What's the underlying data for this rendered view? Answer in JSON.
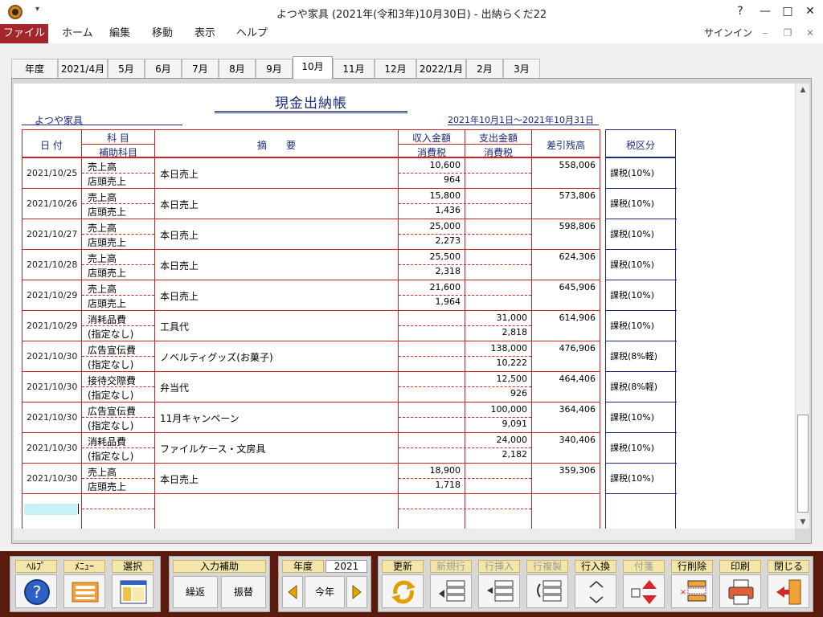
{
  "window": {
    "title": "よつや家具 (2021年(令和3年)10月30日) - 出納らくだ22",
    "help_glyph": "?",
    "minimize_glyph": "—",
    "restore_glyph": "□",
    "close_glyph": "✕"
  },
  "menu": {
    "items": [
      "ファイル",
      "ホーム",
      "編集",
      "移動",
      "表示",
      "ヘルプ"
    ],
    "signin": "サインイン"
  },
  "tabs": [
    "年度",
    "2021/4月",
    "5月",
    "6月",
    "7月",
    "8月",
    "9月",
    "10月",
    "11月",
    "12月",
    "2022/1月",
    "2月",
    "3月"
  ],
  "active_tab": "10月",
  "document": {
    "title": "現金出納帳",
    "company": "よつや家具",
    "period": "2021年10月1日～2021年10月31日",
    "headers": {
      "date": "日 付",
      "account": "科 目",
      "sub_account": "補助科目",
      "description": "摘　　要",
      "income": "収入金額",
      "income_tax": "消費税",
      "expense": "支出金額",
      "expense_tax": "消費税",
      "balance": "差引残高",
      "tax_class": "税区分"
    },
    "entries": [
      {
        "date": "2021/10/25",
        "account": "売上高",
        "sub": "店頭売上",
        "desc": "本日売上",
        "income": "10,600",
        "income_tax": "964",
        "expense": "",
        "expense_tax": "",
        "balance": "558,006",
        "tax": "課税(10%)"
      },
      {
        "date": "2021/10/26",
        "account": "売上高",
        "sub": "店頭売上",
        "desc": "本日売上",
        "income": "15,800",
        "income_tax": "1,436",
        "expense": "",
        "expense_tax": "",
        "balance": "573,806",
        "tax": "課税(10%)"
      },
      {
        "date": "2021/10/27",
        "account": "売上高",
        "sub": "店頭売上",
        "desc": "本日売上",
        "income": "25,000",
        "income_tax": "2,273",
        "expense": "",
        "expense_tax": "",
        "balance": "598,806",
        "tax": "課税(10%)"
      },
      {
        "date": "2021/10/28",
        "account": "売上高",
        "sub": "店頭売上",
        "desc": "本日売上",
        "income": "25,500",
        "income_tax": "2,318",
        "expense": "",
        "expense_tax": "",
        "balance": "624,306",
        "tax": "課税(10%)"
      },
      {
        "date": "2021/10/29",
        "account": "売上高",
        "sub": "店頭売上",
        "desc": "本日売上",
        "income": "21,600",
        "income_tax": "1,964",
        "expense": "",
        "expense_tax": "",
        "balance": "645,906",
        "tax": "課税(10%)"
      },
      {
        "date": "2021/10/29",
        "account": "消耗品費",
        "sub": "(指定なし)",
        "desc": "工具代",
        "income": "",
        "income_tax": "",
        "expense": "31,000",
        "expense_tax": "2,818",
        "balance": "614,906",
        "tax": "課税(10%)"
      },
      {
        "date": "2021/10/30",
        "account": "広告宣伝費",
        "sub": "(指定なし)",
        "desc": "ノベルティグッズ(お菓子)",
        "income": "",
        "income_tax": "",
        "expense": "138,000",
        "expense_tax": "10,222",
        "balance": "476,906",
        "tax": "課税(8%軽)"
      },
      {
        "date": "2021/10/30",
        "account": "接待交際費",
        "sub": "(指定なし)",
        "desc": "弁当代",
        "income": "",
        "income_tax": "",
        "expense": "12,500",
        "expense_tax": "926",
        "balance": "464,406",
        "tax": "課税(8%軽)"
      },
      {
        "date": "2021/10/30",
        "account": "広告宣伝費",
        "sub": "(指定なし)",
        "desc": "11月キャンペーン",
        "income": "",
        "income_tax": "",
        "expense": "100,000",
        "expense_tax": "9,091",
        "balance": "364,406",
        "tax": "課税(10%)"
      },
      {
        "date": "2021/10/30",
        "account": "消耗品費",
        "sub": "(指定なし)",
        "desc": "ファイルケース・文房具",
        "income": "",
        "income_tax": "",
        "expense": "24,000",
        "expense_tax": "2,182",
        "balance": "340,406",
        "tax": "課税(10%)"
      },
      {
        "date": "2021/10/30",
        "account": "売上高",
        "sub": "店頭売上",
        "desc": "本日売上",
        "income": "18,900",
        "income_tax": "1,718",
        "expense": "",
        "expense_tax": "",
        "balance": "359,306",
        "tax": "課税(10%)"
      }
    ]
  },
  "toolbar": {
    "help": "ﾍﾙﾌﾟ",
    "menu": "ﾒﾆｭｰ",
    "select": "選択",
    "input_assist": "入力補助",
    "kurikae": "繰返",
    "furikae": "振替",
    "year_label": "年度",
    "year_value": "2021",
    "this_year": "今年",
    "refresh": "更新",
    "new_row": "新規行",
    "insert_row": "行挿入",
    "copy_row": "行複製",
    "swap_row": "行入換",
    "tag": "付箋",
    "delete_row": "行削除",
    "print": "印刷",
    "close": "閉じる"
  },
  "colors": {
    "file_menu": "#a4262c",
    "ledger_lines": "#cc2222",
    "heading_text": "#1a2a7a",
    "toolbar_bg": "#5b1a0e",
    "button_label_bg": "#f3e6a8"
  }
}
